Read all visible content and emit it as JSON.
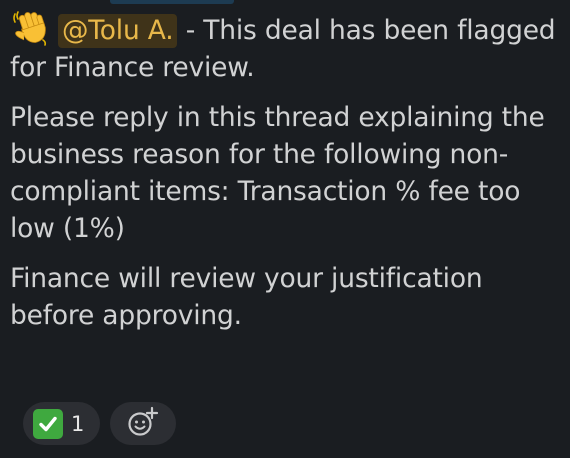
{
  "message": {
    "wave_emoji": "waving-hand-icon",
    "mention": "@Tolu A.",
    "line1_rest": " - This deal has been flagged for Finance review.",
    "paragraph2": "Please reply in this thread explaining the business reason for the following non-compliant items: Transaction % fee too low (1%)",
    "paragraph3": "Finance will review your justification before approving."
  },
  "reactions": {
    "check": {
      "icon": "white-check-mark-icon",
      "count": "1"
    },
    "add_reaction_icon": "add-reaction-icon"
  },
  "colors": {
    "background": "#1a1d21",
    "text": "#d1d2d3",
    "mention_bg": "#3f3319",
    "mention_text": "#e8b84a",
    "reaction_bg": "#2c2e33",
    "check_green": "#3fa93f"
  }
}
